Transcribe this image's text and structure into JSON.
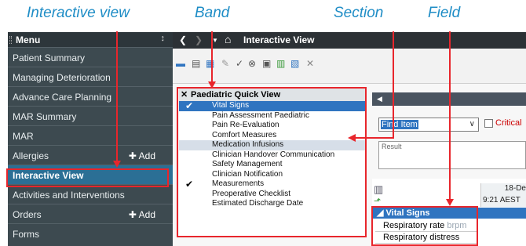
{
  "captions": {
    "interactive_view": "Interactive view",
    "band": "Band",
    "section": "Section",
    "field": "Field"
  },
  "menu": {
    "title": "Menu",
    "pin": "↕",
    "items": [
      {
        "label": "Patient Summary"
      },
      {
        "label": "Managing Deterioration"
      },
      {
        "label": "Advance Care Planning"
      },
      {
        "label": "MAR Summary"
      },
      {
        "label": "MAR"
      },
      {
        "label": "Allergies",
        "add": "✚ Add"
      },
      {
        "label": "Interactive View"
      },
      {
        "label": "Activities and Interventions"
      },
      {
        "label": "Orders",
        "add": "✚ Add"
      },
      {
        "label": "Forms"
      }
    ]
  },
  "topbar": {
    "back": "❮",
    "forward": "❯",
    "home": "⌂",
    "title": "Interactive View"
  },
  "band": {
    "title": "Paediatric Quick View",
    "sections": [
      {
        "label": "Vital Signs",
        "check": "✔"
      },
      {
        "label": "Pain Assessment Paediatric"
      },
      {
        "label": "Pain Re-Evaluation"
      },
      {
        "label": "Comfort Measures"
      },
      {
        "label": "Medication Infusions"
      },
      {
        "label": "Clinician Handover Communication"
      },
      {
        "label": "Safety Management"
      },
      {
        "label": "Clinician Notification"
      },
      {
        "label": "Measurements",
        "check": "✔"
      },
      {
        "label": "Preoperative Checklist"
      },
      {
        "label": "Estimated Discharge Date"
      }
    ]
  },
  "right": {
    "find_value": "Find Item",
    "critical_label": "Critical",
    "result_label": "Result",
    "date_header": "18-De",
    "time_header": "9:21 AEST",
    "section_row": "◢ Vital Signs",
    "fields": [
      {
        "label": "Respiratory rate",
        "unit": "brpm"
      },
      {
        "label": "Respiratory distress",
        "unit": ""
      }
    ]
  },
  "colors": {
    "annotation": "#e8262c",
    "caption": "#1f8dc6",
    "selection": "#2f74c0"
  }
}
